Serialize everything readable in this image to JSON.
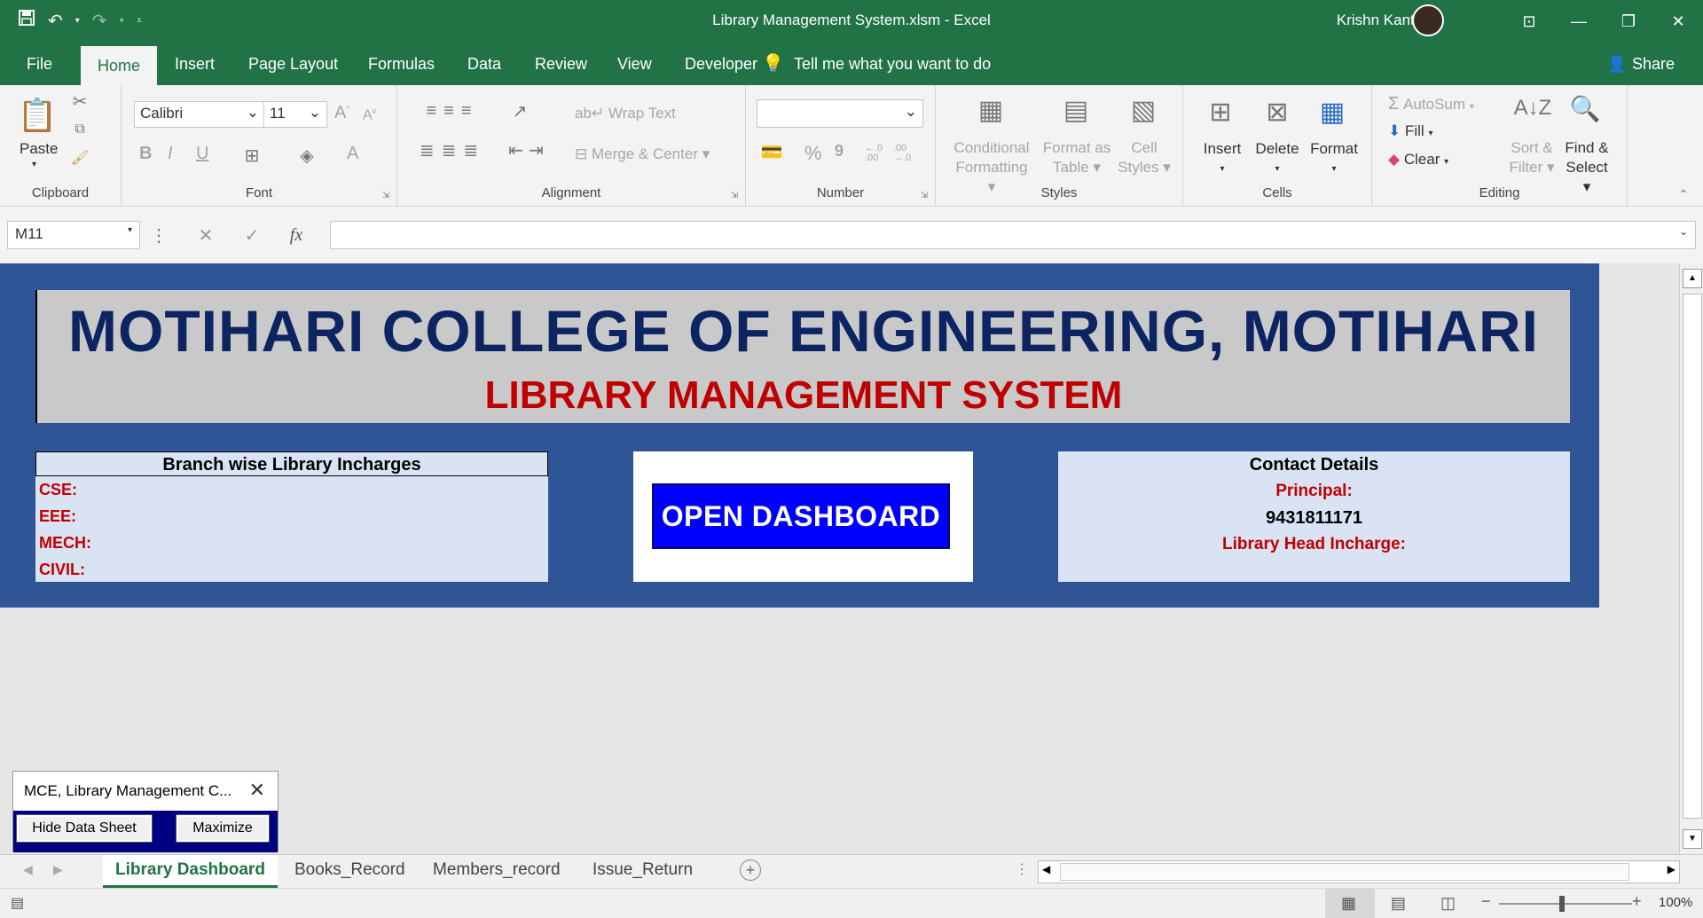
{
  "window": {
    "title": "Library Management System.xlsm  -  Excel",
    "user": "Krishn Kant Raj"
  },
  "ribbon_tabs": [
    "File",
    "Home",
    "Insert",
    "Page Layout",
    "Formulas",
    "Data",
    "Review",
    "View",
    "Developer"
  ],
  "tell_me": "Tell me what you want to do",
  "share": "Share",
  "ribbon": {
    "clipboard": {
      "paste": "Paste",
      "label": "Clipboard"
    },
    "font": {
      "name": "Calibri",
      "size": "11",
      "label": "Font",
      "bold": "B",
      "italic": "I",
      "underline": "U"
    },
    "alignment": {
      "wrap": "Wrap Text",
      "merge": "Merge & Center",
      "label": "Alignment"
    },
    "number": {
      "label": "Number",
      "percent": "%",
      "comma": "9"
    },
    "styles": {
      "cond1": "Conditional",
      "cond2": "Formatting",
      "fmt1": "Format as",
      "fmt2": "Table",
      "cell1": "Cell",
      "cell2": "Styles",
      "label": "Styles"
    },
    "cells": {
      "insert": "Insert",
      "delete": "Delete",
      "format": "Format",
      "label": "Cells"
    },
    "editing": {
      "autosum": "AutoSum",
      "fill": "Fill",
      "clear": "Clear",
      "sort1": "Sort &",
      "sort2": "Filter",
      "find1": "Find &",
      "find2": "Select",
      "label": "Editing"
    }
  },
  "formula_bar": {
    "name_box": "M11",
    "fx": "fx",
    "value": ""
  },
  "sheet": {
    "college": "MOTIHARI COLLEGE OF ENGINEERING, MOTIHARI",
    "system": "LIBRARY MANAGEMENT SYSTEM",
    "incharges": {
      "title": "Branch wise Library Incharges",
      "rows": [
        "CSE:",
        "EEE:",
        "MECH:",
        "CIVIL:"
      ]
    },
    "open_dashboard": "OPEN DASHBOARD",
    "contact": {
      "title": "Contact Details",
      "principal_label": "Principal:",
      "phone": "9431811171",
      "head_label": "Library Head Incharge:"
    }
  },
  "userform": {
    "title": "MCE, Library Management C...",
    "hide_button": "Hide Data Sheet",
    "maximize_button": "Maximize"
  },
  "sheet_tabs": [
    "Library Dashboard",
    "Books_Record",
    "Members_record",
    "Issue_Return"
  ],
  "active_sheet": "Library Dashboard",
  "zoom": "100%",
  "colors": {
    "excel_green": "#217346",
    "banner_blue": "#2f5597",
    "title_navy": "#0c2462",
    "accent_red": "#c00000",
    "button_blue": "#0000ff"
  }
}
